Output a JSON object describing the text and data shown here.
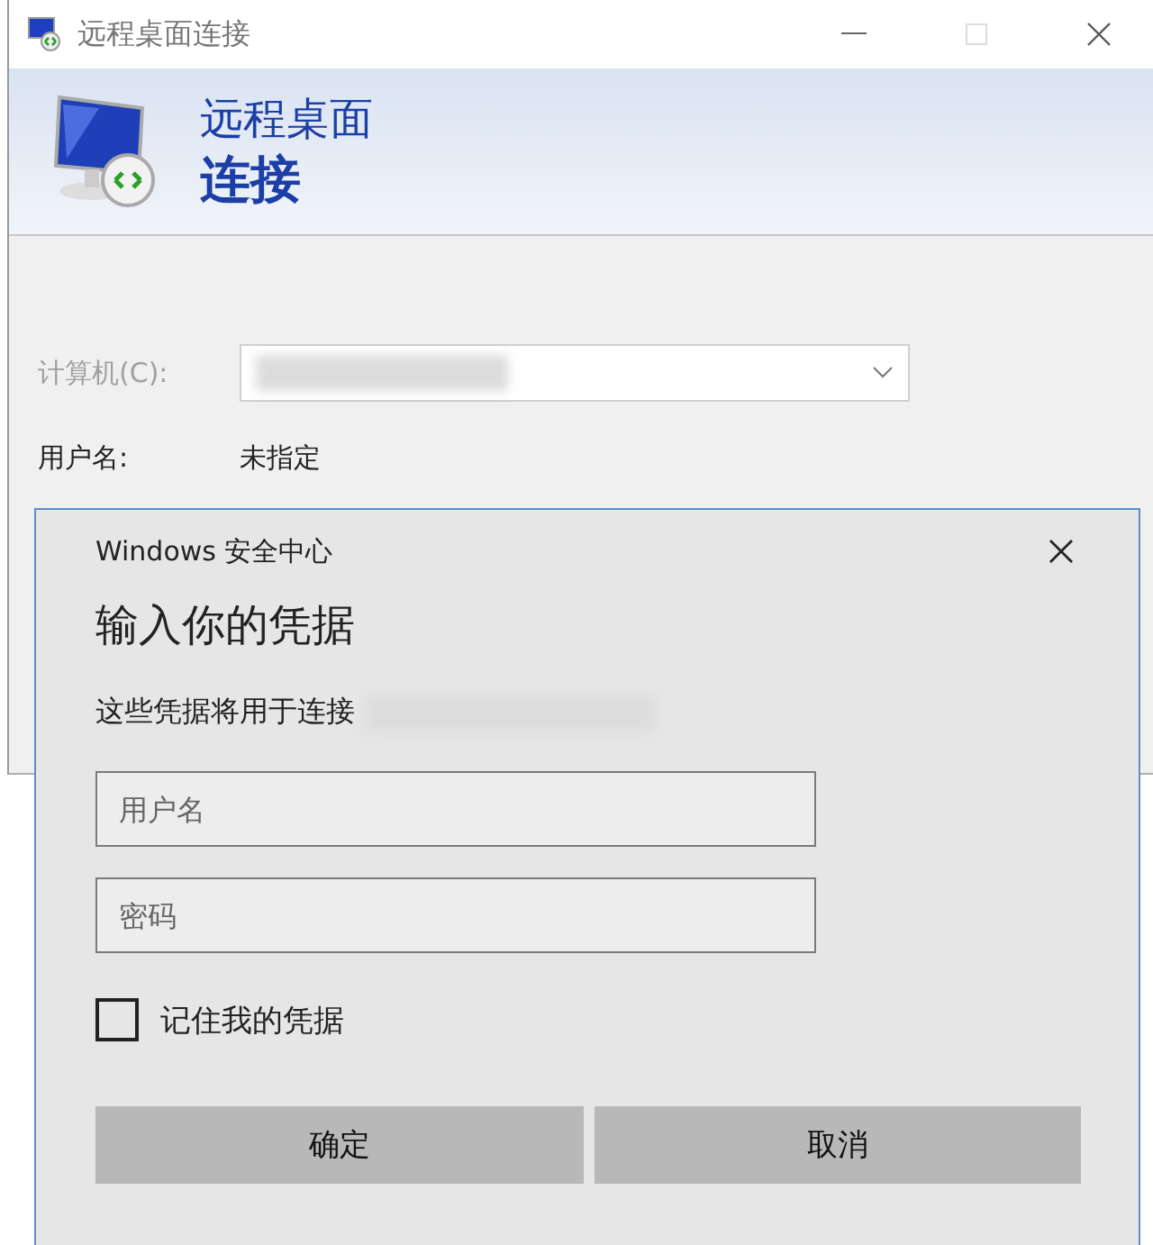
{
  "window": {
    "title": "远程桌面连接"
  },
  "header": {
    "line1": "远程桌面",
    "line2": "连接"
  },
  "form": {
    "computer_label": "计算机(C):",
    "user_label": "用户名:",
    "user_value": "未指定"
  },
  "dialog": {
    "title": "Windows 安全中心",
    "heading": "输入你的凭据",
    "message": "这些凭据将用于连接",
    "fields": [
      {
        "placeholder": "用户名"
      },
      {
        "placeholder": "密码"
      }
    ],
    "remember": {
      "label": "记住我的凭据",
      "checked": false
    },
    "buttons": [
      "确定",
      "取消"
    ]
  }
}
